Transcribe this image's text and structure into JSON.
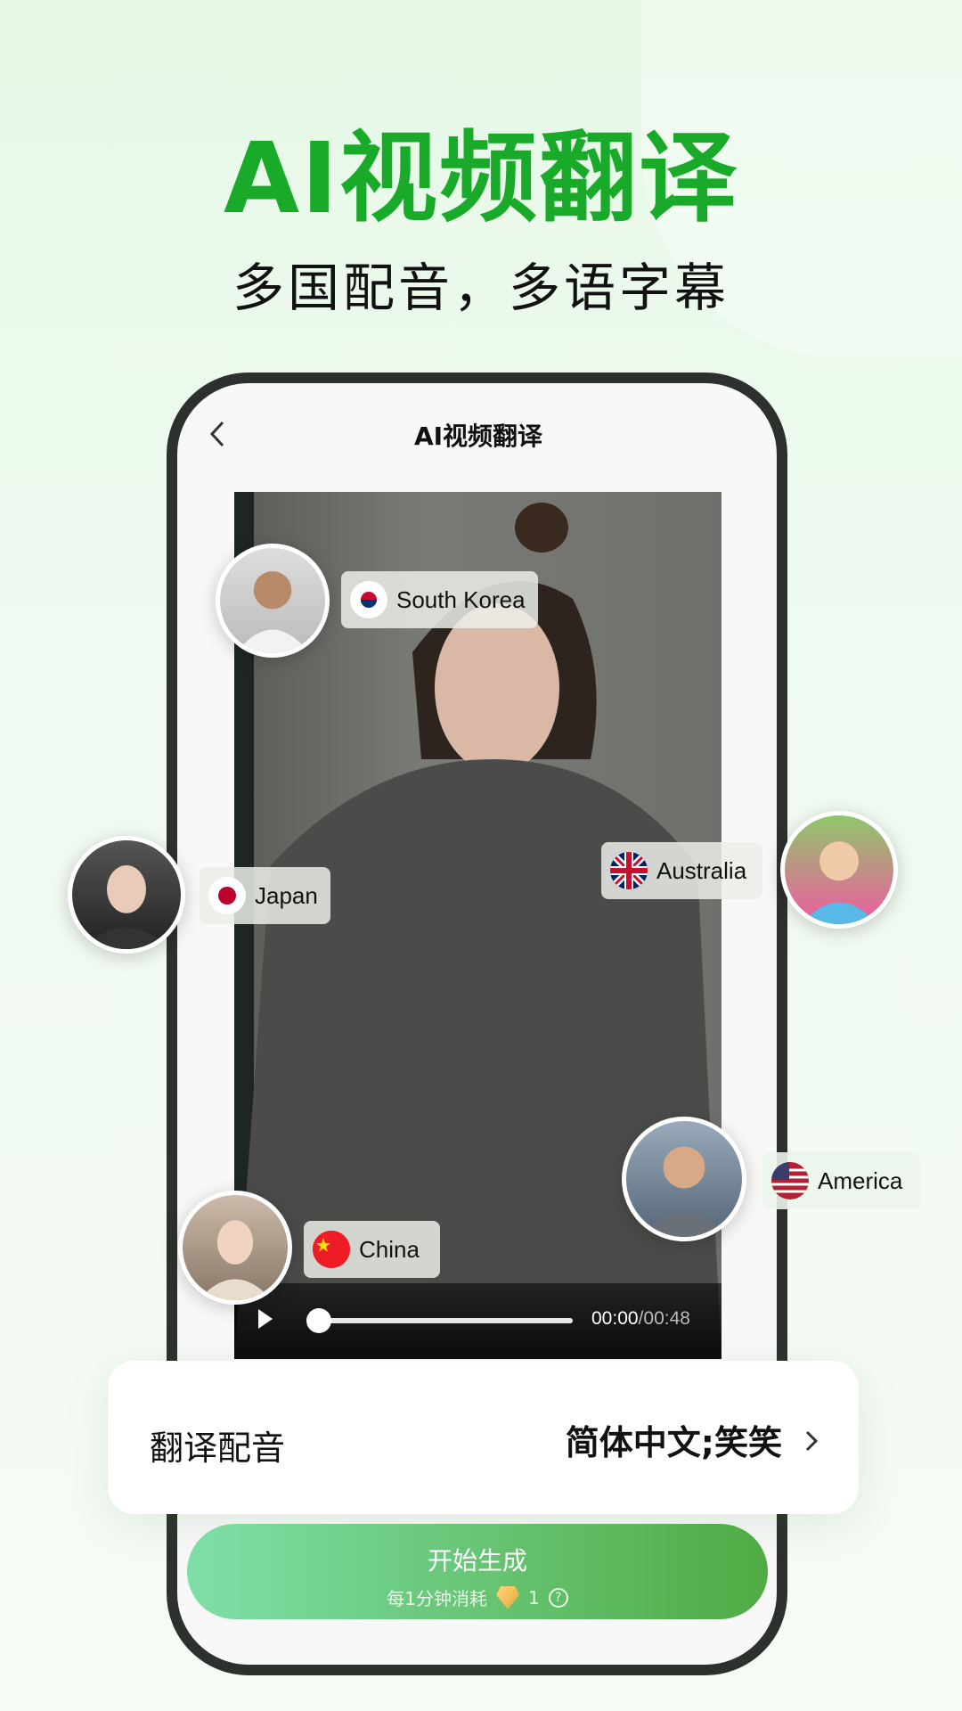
{
  "hero": {
    "title": "AI视频翻译",
    "subtitle": "多国配音，多语字幕"
  },
  "header": {
    "title": "AI视频翻译",
    "back_icon": "chevron-left-icon"
  },
  "player": {
    "current": "00:00",
    "total": "/00:48",
    "progress": 0
  },
  "languages": [
    {
      "country": "South Korea",
      "flag": "flag-south-korea"
    },
    {
      "country": "Japan",
      "flag": "flag-japan"
    },
    {
      "country": "Australia",
      "flag": "flag-australia"
    },
    {
      "country": "America",
      "flag": "flag-usa"
    },
    {
      "country": "China",
      "flag": "flag-china"
    }
  ],
  "dub_card": {
    "label": "翻译配音",
    "value": "简体中文;笑笑"
  },
  "generate": {
    "label": "开始生成",
    "cost_text": "每1分钟消耗",
    "cost": "1",
    "help": "?"
  },
  "colors": {
    "title_green": "#1aaa2a",
    "button_start": "#7fdfa8",
    "button_end": "#4fab43"
  }
}
